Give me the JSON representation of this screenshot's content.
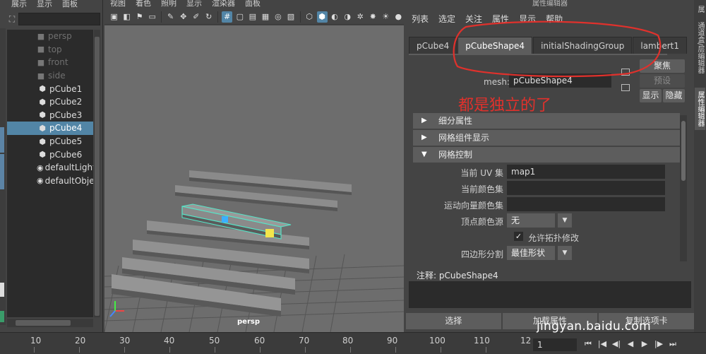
{
  "outliner": {
    "menu": [
      "展示",
      "显示",
      "面板"
    ],
    "items": [
      {
        "label": "persp",
        "icon": "camera-icon",
        "dim": true
      },
      {
        "label": "top",
        "icon": "camera-icon",
        "dim": true
      },
      {
        "label": "front",
        "icon": "camera-icon",
        "dim": true
      },
      {
        "label": "side",
        "icon": "camera-icon",
        "dim": true
      },
      {
        "label": "pCube1",
        "icon": "mesh-icon",
        "dim": false
      },
      {
        "label": "pCube2",
        "icon": "mesh-icon",
        "dim": false
      },
      {
        "label": "pCube3",
        "icon": "mesh-icon",
        "dim": false
      },
      {
        "label": "pCube4",
        "icon": "mesh-icon",
        "dim": false,
        "selected": true
      },
      {
        "label": "pCube5",
        "icon": "mesh-icon",
        "dim": false
      },
      {
        "label": "pCube6",
        "icon": "mesh-icon",
        "dim": false
      },
      {
        "label": "defaultLightSet",
        "icon": "set-icon",
        "dim": false
      },
      {
        "label": "defaultObjectSet",
        "icon": "set-icon",
        "dim": false
      }
    ]
  },
  "viewport": {
    "menu": [
      "视图",
      "着色",
      "照明",
      "显示",
      "渲染器",
      "面板"
    ],
    "camera_label": "persp"
  },
  "attribute_editor": {
    "title": "属性编辑器",
    "menu": [
      "列表",
      "选定",
      "关注",
      "属性",
      "显示",
      "帮助"
    ],
    "tabs": [
      "pCube4",
      "pCubeShape4",
      "initialShadingGroup",
      "lambert1"
    ],
    "active_tab": 1,
    "mesh_label": "mesh:",
    "mesh_value": "pCubeShape4",
    "focus_button": "聚焦",
    "preset_button": "预设",
    "show_button": "显示",
    "hide_button": "隐藏",
    "annotation": "都是独立的了",
    "sections": [
      {
        "label": "细分属性",
        "expanded": false
      },
      {
        "label": "网格组件显示",
        "expanded": false
      },
      {
        "label": "网格控制",
        "expanded": true
      }
    ],
    "mesh_controls": {
      "current_uv_label": "当前 UV 集",
      "current_uv_value": "map1",
      "current_color_label": "当前颜色集",
      "current_color_value": "",
      "motion_vector_label": "运动向量颜色集",
      "motion_vector_value": "",
      "vertex_color_label": "顶点颜色源",
      "vertex_color_value": "无",
      "allow_topology_label": "允许拓扑修改",
      "allow_topology_checked": true,
      "quad_split_label": "四边形分割",
      "quad_split_value": "最佳形状"
    },
    "notes_label": "注释:  pCubeShape4",
    "bottom_buttons": [
      "选择",
      "加载属性",
      "复制选项卡"
    ]
  },
  "right_tabs": [
    "属性编辑器",
    "通道盒/层编辑器",
    "属性编辑器"
  ],
  "timeline": {
    "ticks": [
      "10",
      "20",
      "30",
      "40",
      "50",
      "60",
      "70",
      "80",
      "90",
      "100",
      "110",
      "12"
    ],
    "current_frame": "1"
  },
  "watermark": "jingyan.baidu.com",
  "colors": {
    "selection": "#5285a6",
    "annotation_red": "#e0312c",
    "background": "#444444",
    "field": "#2b2b2b"
  }
}
